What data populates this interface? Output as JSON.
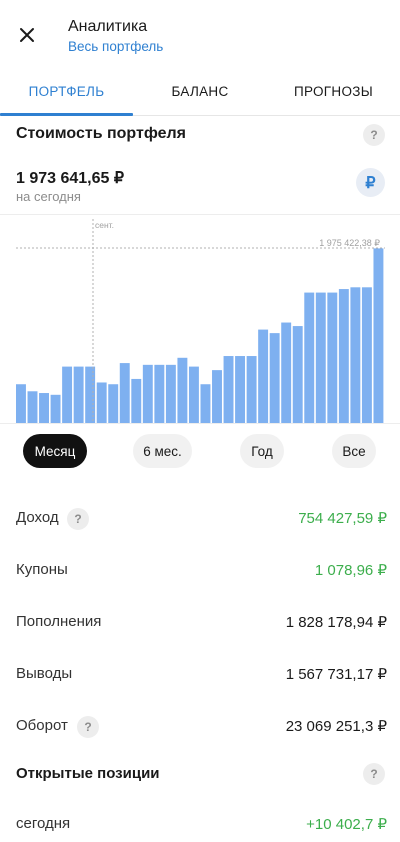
{
  "header": {
    "close_icon": "close-icon",
    "title": "Аналитика",
    "subtitle": "Весь портфель"
  },
  "tabs": [
    {
      "label": "ПОРТФЕЛЬ",
      "active": true
    },
    {
      "label": "БАЛАНС",
      "active": false
    },
    {
      "label": "ПРОГНОЗЫ",
      "active": false
    }
  ],
  "portfolio": {
    "title": "Стоимость портфеля",
    "help": "?",
    "value": "1 973 641,65 ₽",
    "value_caption": "на сегодня",
    "currency_symbol": "₽"
  },
  "chart_data": {
    "type": "bar",
    "title": "",
    "marker_label": "сент.",
    "max_label": "1 975 422,38 ₽",
    "bar_color": "#7eb0f0",
    "values": [
      1590000,
      1570000,
      1565000,
      1560000,
      1640000,
      1640000,
      1640000,
      1595000,
      1590000,
      1650000,
      1605000,
      1645000,
      1645000,
      1645000,
      1665000,
      1640000,
      1590000,
      1630000,
      1670000,
      1670000,
      1670000,
      1745000,
      1735000,
      1765000,
      1755000,
      1850000,
      1850000,
      1850000,
      1860000,
      1865000,
      1865000,
      1975422.38
    ],
    "ylim": [
      1480000,
      1985000
    ]
  },
  "periods": [
    {
      "label": "Месяц",
      "active": true
    },
    {
      "label": "6 мес.",
      "active": false
    },
    {
      "label": "Год",
      "active": false
    },
    {
      "label": "Все",
      "active": false
    }
  ],
  "stats": {
    "income": {
      "label": "Доход",
      "value": "754 427,59 ₽",
      "help": "?"
    },
    "coupons": {
      "label": "Купоны",
      "value": "1 078,96 ₽"
    },
    "deposits": {
      "label": "Пополнения",
      "value": "1 828 178,94 ₽"
    },
    "withdrawals": {
      "label": "Выводы",
      "value": "1 567 731,17 ₽"
    },
    "turnover": {
      "label": "Оборот",
      "value": "23 069 251,3 ₽",
      "help": "?"
    }
  },
  "open_positions": {
    "title": "Открытые позиции",
    "help": "?",
    "today_label": "сегодня",
    "today_value": "+10 402,7 ₽"
  },
  "colors": {
    "accent": "#2f80d1",
    "positive": "#3cae4c",
    "bar": "#7eb0f0"
  }
}
